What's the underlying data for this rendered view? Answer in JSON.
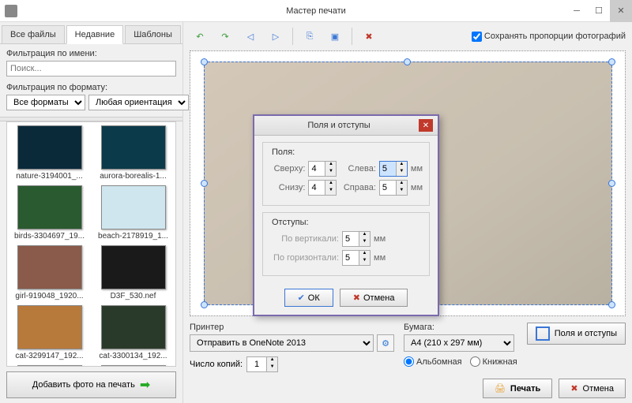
{
  "window": {
    "title": "Мастер печати"
  },
  "tabs": {
    "all": "Все файлы",
    "recent": "Недавние",
    "templates": "Шаблоны"
  },
  "filters": {
    "name_label": "Фильтрация по имени:",
    "search_placeholder": "Поиск...",
    "format_label": "Фильтрация по формату:",
    "format_value": "Все форматы",
    "orient_value": "Любая ориентация"
  },
  "thumbs": [
    {
      "label": "nature-3194001_..."
    },
    {
      "label": "aurora-borealis-1..."
    },
    {
      "label": "birds-3304697_19..."
    },
    {
      "label": "beach-2178919_1..."
    },
    {
      "label": "girl-919048_1920..."
    },
    {
      "label": "D3F_530.nef"
    },
    {
      "label": "cat-3299147_192..."
    },
    {
      "label": "cat-3300134_192..."
    }
  ],
  "thumb_colors": [
    "#0a2a3a",
    "#0b3a4a",
    "#2a5a2f",
    "#cfe6ef",
    "#8a5a4a",
    "#1a1a1a",
    "#b87a3a",
    "#2a3a2a"
  ],
  "add_label": "Добавить фото на печать",
  "preserve_label": "Сохранять пропорции фотографий",
  "printer": {
    "label": "Принтер",
    "value": "Отправить в OneNote 2013",
    "copies_label": "Число копий:",
    "copies_value": "1"
  },
  "paper": {
    "label": "Бумага:",
    "value": "A4 (210 x 297 мм)",
    "landscape": "Альбомная",
    "portrait": "Книжная"
  },
  "margins_btn": "Поля и отступы",
  "print_btn": "Печать",
  "cancel_btn": "Отмена",
  "dialog": {
    "title": "Поля и отступы",
    "fields_label": "Поля:",
    "top": "Сверху:",
    "top_v": "4",
    "left": "Слева:",
    "left_v": "5",
    "bottom": "Снизу:",
    "bottom_v": "4",
    "right": "Справа:",
    "right_v": "5",
    "unit": "мм",
    "gaps_label": "Отступы:",
    "vgap": "По вертикали:",
    "vgap_v": "5",
    "hgap": "По горизонтали:",
    "hgap_v": "5",
    "ok": "ОК",
    "cancel": "Отмена"
  }
}
